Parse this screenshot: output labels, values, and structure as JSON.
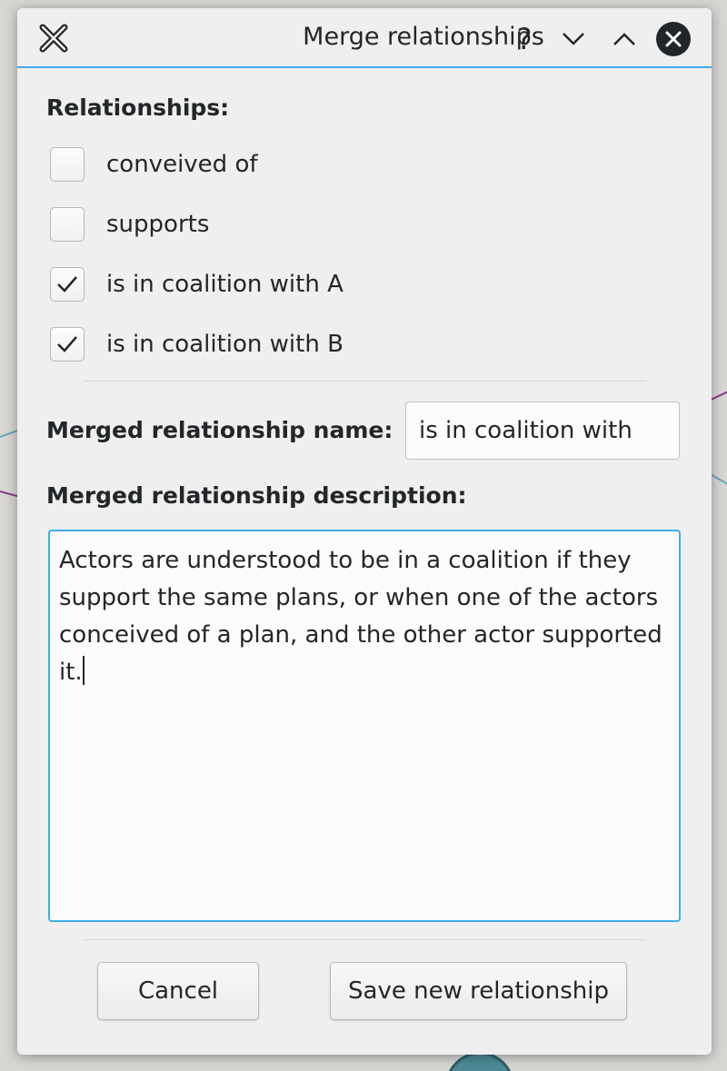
{
  "window": {
    "title": "Merge relationships",
    "help_glyph": "?",
    "icons": [
      "app-x-icon",
      "help-icon",
      "minimize-icon",
      "maximize-icon",
      "close-icon"
    ]
  },
  "relationships": {
    "heading": "Relationships:",
    "items": [
      {
        "label": "conveived of",
        "checked": false
      },
      {
        "label": "supports",
        "checked": false
      },
      {
        "label": "is in coalition with A",
        "checked": true
      },
      {
        "label": "is in coalition with B",
        "checked": true
      }
    ]
  },
  "merged": {
    "name_label": "Merged relationship name:",
    "name_value": "is in coalition with",
    "description_label": "Merged relationship description:",
    "description_value": "Actors are understood to be in a coalition if they support the same plans, or when one of the actors conceived of a plan, and the other actor supported it."
  },
  "buttons": {
    "cancel": "Cancel",
    "save": "Save new relationship"
  },
  "colors": {
    "accent": "#3daee9",
    "dialog_bg": "#efefef",
    "text": "#232629"
  }
}
